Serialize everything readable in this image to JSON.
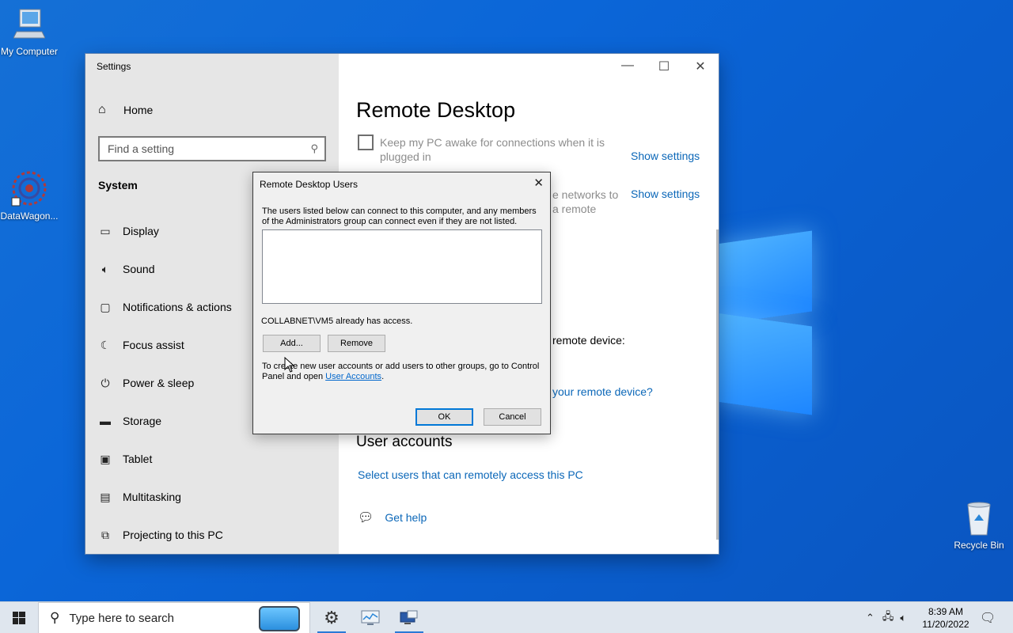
{
  "desktop": {
    "icons": [
      {
        "label": "My Computer"
      },
      {
        "label": "DataWagon..."
      },
      {
        "label": "Recycle Bin"
      }
    ]
  },
  "settings": {
    "window_title": "Settings",
    "home_label": "Home",
    "search_placeholder": "Find a setting",
    "section": "System",
    "nav": [
      {
        "label": "Display",
        "icon": "monitor-icon"
      },
      {
        "label": "Sound",
        "icon": "speaker-icon"
      },
      {
        "label": "Notifications & actions",
        "icon": "notification-icon"
      },
      {
        "label": "Focus assist",
        "icon": "moon-icon"
      },
      {
        "label": "Power & sleep",
        "icon": "power-icon"
      },
      {
        "label": "Storage",
        "icon": "storage-icon"
      },
      {
        "label": "Tablet",
        "icon": "tablet-icon"
      },
      {
        "label": "Multitasking",
        "icon": "multitasking-icon"
      },
      {
        "label": "Projecting to this PC",
        "icon": "projecting-icon"
      }
    ],
    "content": {
      "title": "Remote Desktop",
      "keep_awake_line1": "Keep my PC awake for connections when it is",
      "keep_awake_line2": "plugged in",
      "show_settings_1": "Show settings",
      "partial_networks_line1": "e networks to",
      "partial_networks_line2": "a remote",
      "show_settings_2": "Show settings",
      "partial_remote_device": "remote device:",
      "partial_remote_device_link": "your remote device?",
      "user_accounts_heading": "User accounts",
      "select_users_link": "Select users that can remotely access this PC",
      "get_help": "Get help"
    }
  },
  "dialog": {
    "title": "Remote Desktop Users",
    "description": "The users listed below can connect to this computer, and any members of the Administrators group can connect even if they are not listed.",
    "access_text": "COLLABNET\\VM5 already has access.",
    "add_button": "Add...",
    "remove_button": "Remove",
    "note_prefix": "To create new user accounts or add users to other groups, go to Control Panel and open ",
    "note_link": "User Accounts",
    "note_suffix": ".",
    "ok_button": "OK",
    "cancel_button": "Cancel"
  },
  "taskbar": {
    "search_placeholder": "Type here to search",
    "time": "8:39 AM",
    "date": "11/20/2022"
  }
}
